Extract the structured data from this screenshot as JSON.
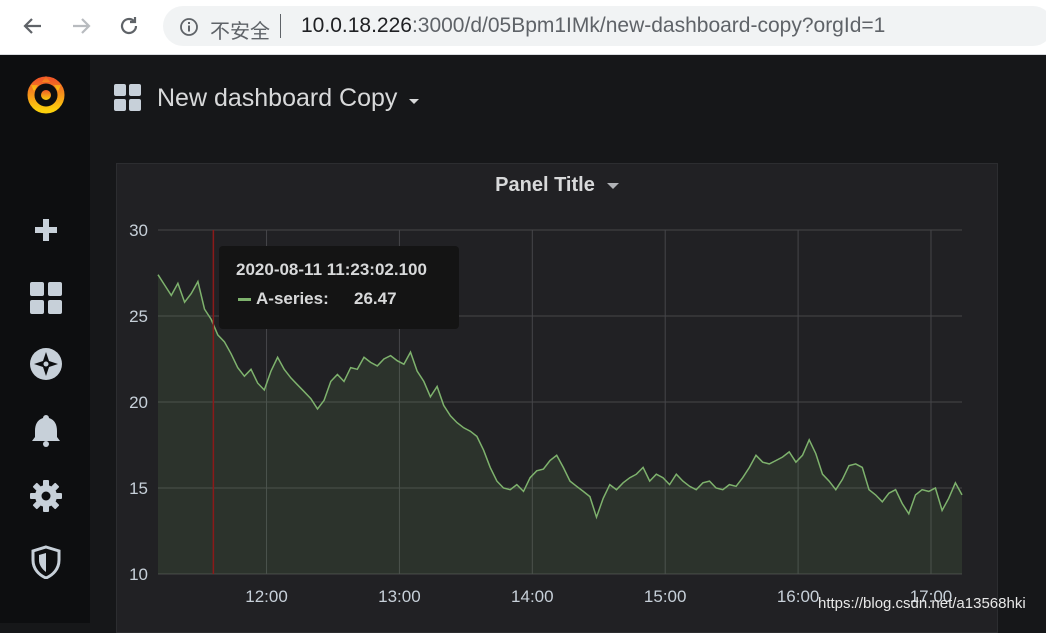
{
  "browser": {
    "insecure_label": "不安全",
    "url_host": "10.0.18.226",
    "url_rest": ":3000/d/05Bpm1IMk/new-dashboard-copy?orgId=1",
    "icons": [
      "back-arrow-icon",
      "forward-arrow-icon",
      "reload-icon",
      "info-icon"
    ]
  },
  "sidemenu": {
    "icons": [
      "grafana-logo-icon",
      "plus-icon",
      "dashboards-icon",
      "explore-compass-icon",
      "alerting-bell-icon",
      "configuration-gear-icon",
      "server-admin-shield-icon"
    ]
  },
  "dashboard": {
    "title": "New dashboard Copy"
  },
  "panel": {
    "title": "Panel Title"
  },
  "tooltip": {
    "time": "2020-08-11 11:23:02.100",
    "series": "A-series:",
    "value": "26.47"
  },
  "watermark": "https://blog.csdn.net/a13568hki",
  "chart_data": {
    "type": "area",
    "colors": {
      "line": "#7eb26d",
      "fill": "rgba(126,178,109,0.12)",
      "grid": "#464649",
      "hover": "#8b1a1a"
    },
    "ylim": [
      10,
      30
    ],
    "yticks": [
      10,
      15,
      20,
      25,
      30
    ],
    "xticks": [
      "12:00",
      "13:00",
      "14:00",
      "15:00",
      "16:00",
      "17:00"
    ],
    "xlim_minutes": [
      671,
      1034
    ],
    "hover_minutes": 696,
    "series": [
      {
        "name": "A-series",
        "x_minutes": [
          671,
          674,
          677,
          680,
          683,
          686,
          689,
          692,
          695,
          698,
          701,
          704,
          707,
          710,
          713,
          716,
          719,
          722,
          725,
          728,
          731,
          734,
          737,
          740,
          743,
          746,
          749,
          752,
          755,
          758,
          761,
          764,
          767,
          770,
          773,
          776,
          779,
          782,
          785,
          788,
          791,
          794,
          797,
          800,
          803,
          806,
          809,
          812,
          815,
          818,
          821,
          824,
          827,
          830,
          833,
          836,
          839,
          842,
          845,
          848,
          851,
          854,
          857,
          860,
          863,
          866,
          869,
          872,
          875,
          878,
          881,
          884,
          887,
          890,
          893,
          896,
          899,
          902,
          905,
          908,
          911,
          914,
          917,
          920,
          923,
          926,
          929,
          932,
          935,
          938,
          941,
          944,
          947,
          950,
          953,
          956,
          959,
          962,
          965,
          968,
          971,
          974,
          977,
          980,
          983,
          986,
          989,
          992,
          995,
          998,
          1001,
          1004,
          1007,
          1010,
          1013,
          1016,
          1019,
          1022,
          1025,
          1028,
          1031,
          1034
        ],
        "values": [
          27.4,
          26.8,
          26.2,
          26.9,
          25.8,
          26.3,
          27.0,
          25.4,
          24.8,
          23.9,
          23.5,
          22.8,
          22.0,
          21.5,
          21.9,
          21.1,
          20.7,
          21.8,
          22.6,
          21.9,
          21.4,
          21.0,
          20.6,
          20.2,
          19.6,
          20.1,
          21.2,
          21.6,
          21.2,
          22.0,
          21.9,
          22.6,
          22.3,
          22.1,
          22.5,
          22.7,
          22.4,
          22.2,
          22.9,
          21.8,
          21.2,
          20.3,
          20.9,
          19.8,
          19.2,
          18.8,
          18.5,
          18.3,
          18.0,
          17.2,
          16.2,
          15.4,
          15.0,
          14.9,
          15.2,
          14.8,
          15.6,
          16.0,
          16.1,
          16.6,
          16.9,
          16.2,
          15.4,
          15.1,
          14.8,
          14.5,
          13.3,
          14.4,
          15.2,
          14.9,
          15.3,
          15.6,
          15.8,
          16.2,
          15.4,
          15.8,
          15.6,
          15.2,
          15.8,
          15.4,
          15.1,
          14.9,
          15.3,
          15.4,
          15.0,
          14.9,
          15.2,
          15.1,
          15.6,
          16.2,
          16.9,
          16.5,
          16.4,
          16.6,
          16.8,
          17.1,
          16.5,
          16.9,
          17.8,
          17.0,
          15.8,
          15.4,
          14.9,
          15.5,
          16.3,
          16.4,
          16.2,
          14.9,
          14.6,
          14.2,
          14.7,
          14.9,
          14.1,
          13.5,
          14.6,
          14.9,
          14.8,
          15.0,
          13.7,
          14.4,
          15.3,
          14.6
        ]
      }
    ]
  }
}
